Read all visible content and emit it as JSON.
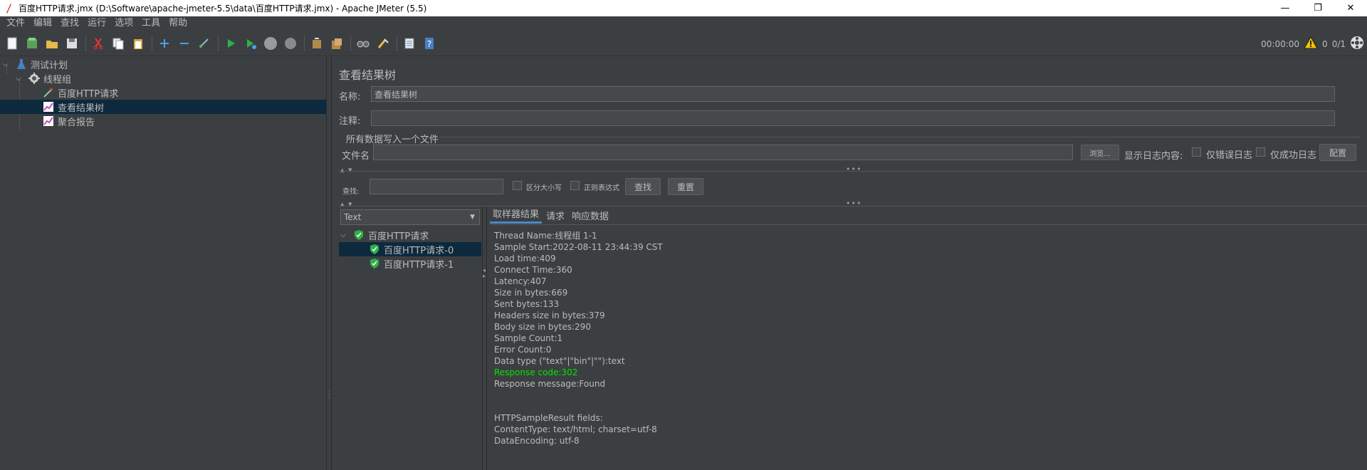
{
  "window": {
    "title": "百度HTTP请求.jmx (D:\\Software\\apache-jmeter-5.5\\data\\百度HTTP请求.jmx) - Apache JMeter (5.5)",
    "minimize": "—",
    "maximize": "❐",
    "close": "✕"
  },
  "menu": [
    "文件",
    "编辑",
    "查找",
    "运行",
    "选项",
    "工具",
    "帮助"
  ],
  "toolbar": {
    "timer": "00:00:00",
    "warnings": "0",
    "threads": "0/1"
  },
  "tree": {
    "items": [
      {
        "label": "测试计划",
        "icon": "flask-icon"
      },
      {
        "label": "线程组",
        "icon": "gear-icon"
      },
      {
        "label": "百度HTTP请求",
        "icon": "pipette-icon"
      },
      {
        "label": "查看结果树",
        "icon": "chart-icon"
      },
      {
        "label": "聚合报告",
        "icon": "chart-icon"
      }
    ]
  },
  "panel": {
    "title": "查看结果树",
    "name_label": "名称:",
    "name_value": "查看结果树",
    "comment_label": "注释:",
    "comment_value": "",
    "file_section": "所有数据写入一个文件",
    "filename_label": "文件名",
    "filename_value": "",
    "browse": "浏览...",
    "log_label": "显示日志内容:",
    "errors_only": "仅错误日志",
    "success_only": "仅成功日志",
    "configure": "配置",
    "search_label": "查找:",
    "search_value": "",
    "case_sensitive": "区分大小写",
    "regex": "正则表达式",
    "find_button": "查找",
    "reset_button": "重置"
  },
  "renderer": {
    "selected": "Text"
  },
  "results": [
    {
      "label": "百度HTTP请求",
      "status": "success"
    },
    {
      "label": "百度HTTP请求-0",
      "status": "success"
    },
    {
      "label": "百度HTTP请求-1",
      "status": "success"
    }
  ],
  "tabs": [
    "取样器结果",
    "请求",
    "响应数据"
  ],
  "detail_lines": [
    "Thread Name:线程组 1-1",
    "Sample Start:2022-08-11 23:44:39 CST",
    "Load time:409",
    "Connect Time:360",
    "Latency:407",
    "Size in bytes:669",
    "Sent bytes:133",
    "Headers size in bytes:379",
    "Body size in bytes:290",
    "Sample Count:1",
    "Error Count:0",
    "Data type (\"text\"|\"bin\"|\"\"):text",
    "Response code:302",
    "Response message:Found",
    "",
    "",
    "HTTPSampleResult fields:",
    "ContentType: text/html; charset=utf-8",
    "DataEncoding: utf-8"
  ],
  "colors": {
    "accent": "#4a88c7",
    "success": "#00e600",
    "background": "#3c3f41"
  }
}
